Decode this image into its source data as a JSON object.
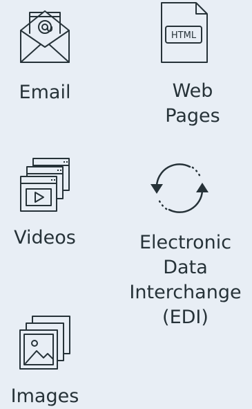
{
  "colors": {
    "background": "#e8eef5",
    "icon_stroke": "#263238",
    "text": "#263238"
  },
  "items": [
    {
      "icon": "email-envelope-icon",
      "label_lines": [
        "Email"
      ]
    },
    {
      "icon": "html-file-icon",
      "icon_text": "HTML",
      "label_lines": [
        "Web",
        "Pages"
      ]
    },
    {
      "icon": "video-windows-icon",
      "label_lines": [
        "Videos"
      ]
    },
    {
      "icon": "sync-arrows-icon",
      "label_lines": [
        "Electronic",
        "Data",
        "Interchange",
        "(EDI)"
      ]
    },
    {
      "icon": "image-gallery-icon",
      "label_lines": [
        "Images"
      ]
    }
  ]
}
